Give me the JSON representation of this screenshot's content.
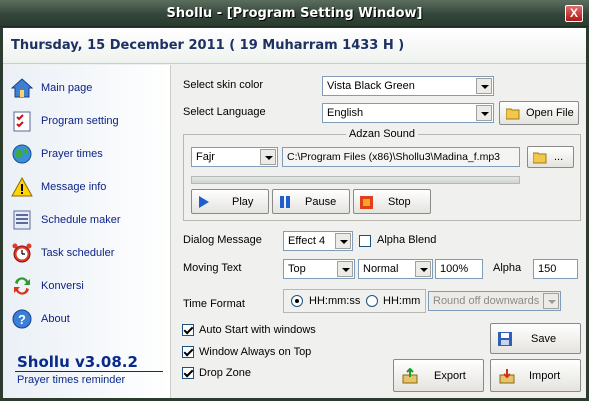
{
  "window": {
    "title": "Shollu - [Program Setting Window]",
    "close": "X"
  },
  "header": {
    "date": "Thursday, 15 December 2011 ( 19 Muharram 1433 H )"
  },
  "sidebar": {
    "items": [
      {
        "label": "Main page",
        "icon": "home-icon"
      },
      {
        "label": "Program setting",
        "icon": "checklist-icon"
      },
      {
        "label": "Prayer times",
        "icon": "globe-icon"
      },
      {
        "label": "Message info",
        "icon": "warning-icon"
      },
      {
        "label": "Schedule maker",
        "icon": "schedule-icon"
      },
      {
        "label": "Task scheduler",
        "icon": "alarm-clock-icon"
      },
      {
        "label": "Konversi",
        "icon": "convert-icon"
      },
      {
        "label": "About",
        "icon": "help-icon"
      }
    ],
    "brand": "Shollu v3.08.2",
    "brand_sub": "Prayer times reminder"
  },
  "settings": {
    "skin_label": "Select skin color",
    "skin_value": "Vista Black Green",
    "language_label": "Select Language",
    "language_value": "English",
    "open_file": "Open File",
    "adzan": {
      "title": "Adzan Sound",
      "prayer": "Fajr",
      "path": "C:\\Program Files (x86)\\Shollu3\\Madina_f.mp3",
      "browse": "...",
      "play": "Play",
      "pause": "Pause",
      "stop": "Stop",
      "progress": 0
    },
    "dialog_label": "Dialog Message",
    "dialog_value": "Effect 4",
    "alpha_blend": "Alpha Blend",
    "alpha_blend_checked": false,
    "moving_label": "Moving Text",
    "moving_position": "Top",
    "moving_speed": "Normal",
    "moving_percent": "100%",
    "alpha_label": "Alpha",
    "alpha_value": "150",
    "time_label": "Time Format",
    "time_option_1": "HH:mm:ss",
    "time_option_2": "HH:mm",
    "time_selected": "HH:mm:ss",
    "round_value": "Round off downwards",
    "auto_start": "Auto Start with windows",
    "always_on_top": "Window Always on Top",
    "drop_zone": "Drop Zone",
    "save": "Save",
    "export": "Export",
    "import": "Import"
  },
  "colors": {
    "title_bar": "#33463a",
    "accent": "#0a1f86",
    "background": "#f0f0ee"
  }
}
